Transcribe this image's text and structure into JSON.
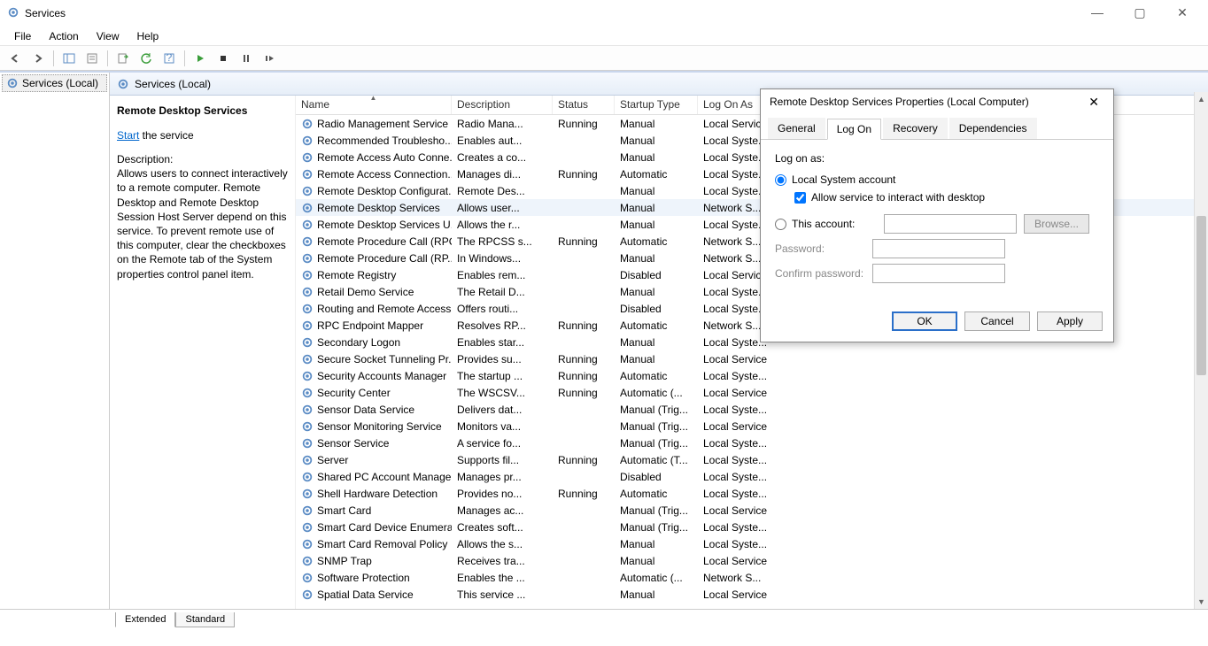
{
  "window": {
    "title": "Services"
  },
  "menu": [
    "File",
    "Action",
    "View",
    "Help"
  ],
  "leftPane": {
    "item": "Services (Local)"
  },
  "paneHeader": "Services (Local)",
  "detail": {
    "title": "Remote Desktop Services",
    "linkPrefix": "Start",
    "linkSuffix": " the service",
    "descLabel": "Description:",
    "description": "Allows users to connect interactively to a remote computer. Remote Desktop and Remote Desktop Session Host Server depend on this service. To prevent remote use of this computer, clear the checkboxes on the Remote tab of the System properties control panel item."
  },
  "columns": {
    "name": "Name",
    "desc": "Description",
    "status": "Status",
    "startup": "Startup Type",
    "logon": "Log On As"
  },
  "services": [
    {
      "name": "Radio Management Service",
      "desc": "Radio Mana...",
      "status": "Running",
      "startup": "Manual",
      "logon": "Local Service"
    },
    {
      "name": "Recommended Troublesho...",
      "desc": "Enables aut...",
      "status": "",
      "startup": "Manual",
      "logon": "Local Syste..."
    },
    {
      "name": "Remote Access Auto Conne...",
      "desc": "Creates a co...",
      "status": "",
      "startup": "Manual",
      "logon": "Local Syste..."
    },
    {
      "name": "Remote Access Connection...",
      "desc": "Manages di...",
      "status": "Running",
      "startup": "Automatic",
      "logon": "Local Syste..."
    },
    {
      "name": "Remote Desktop Configurat...",
      "desc": "Remote Des...",
      "status": "",
      "startup": "Manual",
      "logon": "Local Syste..."
    },
    {
      "name": "Remote Desktop Services",
      "desc": "Allows user...",
      "status": "",
      "startup": "Manual",
      "logon": "Network S...",
      "selected": true
    },
    {
      "name": "Remote Desktop Services U...",
      "desc": "Allows the r...",
      "status": "",
      "startup": "Manual",
      "logon": "Local Syste..."
    },
    {
      "name": "Remote Procedure Call (RPC)",
      "desc": "The RPCSS s...",
      "status": "Running",
      "startup": "Automatic",
      "logon": "Network S..."
    },
    {
      "name": "Remote Procedure Call (RP...",
      "desc": "In Windows...",
      "status": "",
      "startup": "Manual",
      "logon": "Network S..."
    },
    {
      "name": "Remote Registry",
      "desc": "Enables rem...",
      "status": "",
      "startup": "Disabled",
      "logon": "Local Service"
    },
    {
      "name": "Retail Demo Service",
      "desc": "The Retail D...",
      "status": "",
      "startup": "Manual",
      "logon": "Local Syste..."
    },
    {
      "name": "Routing and Remote Access",
      "desc": "Offers routi...",
      "status": "",
      "startup": "Disabled",
      "logon": "Local Syste..."
    },
    {
      "name": "RPC Endpoint Mapper",
      "desc": "Resolves RP...",
      "status": "Running",
      "startup": "Automatic",
      "logon": "Network S..."
    },
    {
      "name": "Secondary Logon",
      "desc": "Enables star...",
      "status": "",
      "startup": "Manual",
      "logon": "Local Syste..."
    },
    {
      "name": "Secure Socket Tunneling Pr...",
      "desc": "Provides su...",
      "status": "Running",
      "startup": "Manual",
      "logon": "Local Service"
    },
    {
      "name": "Security Accounts Manager",
      "desc": "The startup ...",
      "status": "Running",
      "startup": "Automatic",
      "logon": "Local Syste..."
    },
    {
      "name": "Security Center",
      "desc": "The WSCSV...",
      "status": "Running",
      "startup": "Automatic (...",
      "logon": "Local Service"
    },
    {
      "name": "Sensor Data Service",
      "desc": "Delivers dat...",
      "status": "",
      "startup": "Manual (Trig...",
      "logon": "Local Syste..."
    },
    {
      "name": "Sensor Monitoring Service",
      "desc": "Monitors va...",
      "status": "",
      "startup": "Manual (Trig...",
      "logon": "Local Service"
    },
    {
      "name": "Sensor Service",
      "desc": "A service fo...",
      "status": "",
      "startup": "Manual (Trig...",
      "logon": "Local Syste..."
    },
    {
      "name": "Server",
      "desc": "Supports fil...",
      "status": "Running",
      "startup": "Automatic (T...",
      "logon": "Local Syste..."
    },
    {
      "name": "Shared PC Account Manager",
      "desc": "Manages pr...",
      "status": "",
      "startup": "Disabled",
      "logon": "Local Syste..."
    },
    {
      "name": "Shell Hardware Detection",
      "desc": "Provides no...",
      "status": "Running",
      "startup": "Automatic",
      "logon": "Local Syste..."
    },
    {
      "name": "Smart Card",
      "desc": "Manages ac...",
      "status": "",
      "startup": "Manual (Trig...",
      "logon": "Local Service"
    },
    {
      "name": "Smart Card Device Enumera...",
      "desc": "Creates soft...",
      "status": "",
      "startup": "Manual (Trig...",
      "logon": "Local Syste..."
    },
    {
      "name": "Smart Card Removal Policy",
      "desc": "Allows the s...",
      "status": "",
      "startup": "Manual",
      "logon": "Local Syste..."
    },
    {
      "name": "SNMP Trap",
      "desc": "Receives tra...",
      "status": "",
      "startup": "Manual",
      "logon": "Local Service"
    },
    {
      "name": "Software Protection",
      "desc": "Enables the ...",
      "status": "",
      "startup": "Automatic (...",
      "logon": "Network S..."
    },
    {
      "name": "Spatial Data Service",
      "desc": "This service ...",
      "status": "",
      "startup": "Manual",
      "logon": "Local Service"
    }
  ],
  "bottomTabs": {
    "extended": "Extended",
    "standard": "Standard"
  },
  "dialog": {
    "title": "Remote Desktop Services Properties (Local Computer)",
    "tabs": [
      "General",
      "Log On",
      "Recovery",
      "Dependencies"
    ],
    "activeTab": 1,
    "logOnAsLabel": "Log on as:",
    "localSystemLabel": "Local System account",
    "interactLabel": "Allow service to interact with desktop",
    "thisAccountLabel": "This account:",
    "browseLabel": "Browse...",
    "passwordLabel": "Password:",
    "confirmLabel": "Confirm password:",
    "ok": "OK",
    "cancel": "Cancel",
    "apply": "Apply"
  }
}
